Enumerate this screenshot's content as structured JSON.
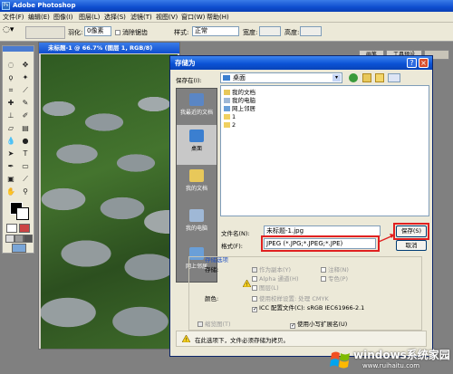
{
  "app": {
    "title": "Adobe Photoshop",
    "menu": [
      "文件(F)",
      "编辑(E)",
      "图像(I)",
      "图层(L)",
      "选择(S)",
      "滤镜(T)",
      "视图(V)",
      "窗口(W)",
      "帮助(H)"
    ],
    "options": {
      "feather_label": "羽化:",
      "feather_value": "0像素",
      "antialias_label": "消除锯齿",
      "style_label": "样式:",
      "style_value": "正常",
      "width_label": "宽度:",
      "height_label": "高度:",
      "tab_brushes": "画笔",
      "tab_tools": "工具预设"
    }
  },
  "document": {
    "title": "未标题-1 @ 66.7% (图层 1, RGB/8)"
  },
  "dialog": {
    "title": "存储为",
    "save_in_label": "保存在(I):",
    "save_in_value": "桌面",
    "places": [
      {
        "label": "我最近的文档",
        "icon": "recent-docs-icon",
        "color": "#5a86c5"
      },
      {
        "label": "桌面",
        "icon": "desktop-icon",
        "color": "#3b7fd0"
      },
      {
        "label": "我的文档",
        "icon": "my-documents-icon",
        "color": "#e8c85a"
      },
      {
        "label": "我的电脑",
        "icon": "my-computer-icon",
        "color": "#9fb8d6"
      },
      {
        "label": "网上邻居",
        "icon": "network-icon",
        "color": "#6a9fd8"
      }
    ],
    "files": [
      {
        "name": "我的文档",
        "color": "#e8c85a"
      },
      {
        "name": "我的电脑",
        "color": "#9fb8d6"
      },
      {
        "name": "网上邻居",
        "color": "#6a9fd8"
      },
      {
        "name": "1",
        "color": "#f0d060"
      },
      {
        "name": "2",
        "color": "#f0d060"
      }
    ],
    "filename_label": "文件名(N):",
    "filename_value": "未标题-1.jpg",
    "format_label": "格式(F):",
    "format_value": "JPEG (*.JPG;*.JPEG;*.JPE)",
    "save_button": "保存(S)",
    "cancel_button": "取消",
    "save_options_title": "存储选项",
    "storage_label": "存储:",
    "as_copy": "作为副本(Y)",
    "alpha_channels": "Alpha 通道(H)",
    "layers": "图层(L)",
    "annotations": "注释(N)",
    "spot_colors": "专色(P)",
    "color_label": "颜色:",
    "proof_setup": "使用校样设置: 处理 CMYK",
    "icc_profile": "ICC 配置文件(C): sRGB IEC61966-2.1",
    "thumbnail": "缩览图(T)",
    "lowercase_ext": "使用小写扩展名(U)",
    "warning_text": "在此选项下，文件必须存储为拷贝。"
  },
  "watermark": {
    "brand": "windows系统家园",
    "url": "www.ruihaitu.com"
  },
  "colors": {
    "title_blue": "#0b53d6",
    "highlight_red": "#e02020",
    "face": "#ece9d8"
  }
}
